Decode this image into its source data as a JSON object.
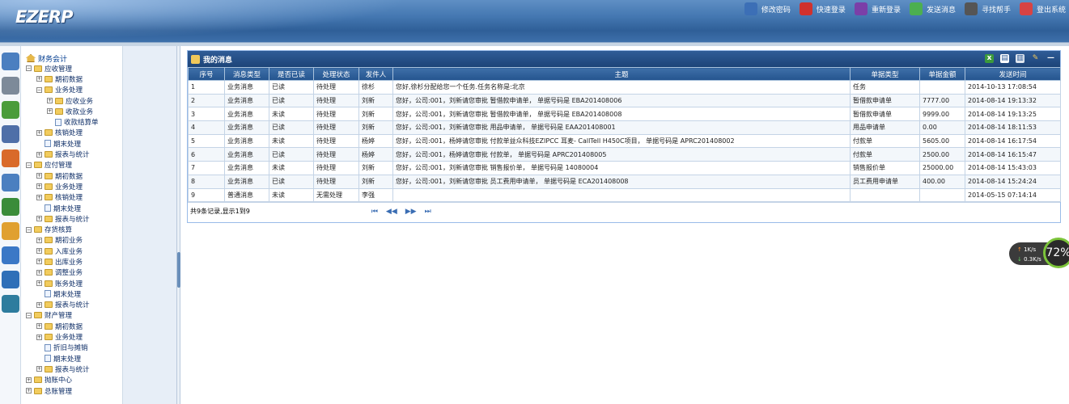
{
  "app": {
    "logo": "EZERP",
    "colors": {
      "header": "#3f72ad",
      "table_header": "#2f5c97",
      "accent": "#99bbe8"
    }
  },
  "topnav": [
    {
      "label": "修改密码",
      "icon": "user-edit-icon",
      "color": "#3c6fb6"
    },
    {
      "label": "快速登录",
      "icon": "car-icon",
      "color": "#d0312d"
    },
    {
      "label": "重新登录",
      "icon": "runner-icon",
      "color": "#7b3fa8"
    },
    {
      "label": "发送消息",
      "icon": "chat-icon",
      "color": "#4caf50"
    },
    {
      "label": "寻找帮手",
      "icon": "magnifier-icon",
      "color": "#555555"
    },
    {
      "label": "登出系统",
      "icon": "power-icon",
      "color": "#d84343"
    }
  ],
  "tree": {
    "root": "财务会计",
    "nodes": [
      {
        "label": "应收管理",
        "level": 0,
        "type": "folder",
        "toggle": "−"
      },
      {
        "label": "期初数据",
        "level": 1,
        "type": "folder",
        "toggle": "+"
      },
      {
        "label": "业务处理",
        "level": 1,
        "type": "folder",
        "toggle": "−"
      },
      {
        "label": "应收业务",
        "level": 2,
        "type": "folder",
        "toggle": "+"
      },
      {
        "label": "收款业务",
        "level": 2,
        "type": "folder",
        "toggle": "+"
      },
      {
        "label": "收款结算单",
        "level": 2,
        "type": "page",
        "toggle": ""
      },
      {
        "label": "核销处理",
        "level": 1,
        "type": "folder",
        "toggle": "+"
      },
      {
        "label": "期末处理",
        "level": 1,
        "type": "page",
        "toggle": ""
      },
      {
        "label": "报表与统计",
        "level": 1,
        "type": "folder",
        "toggle": "+"
      },
      {
        "label": "应付管理",
        "level": 0,
        "type": "folder",
        "toggle": "−"
      },
      {
        "label": "期初数据",
        "level": 1,
        "type": "folder",
        "toggle": "+"
      },
      {
        "label": "业务处理",
        "level": 1,
        "type": "folder",
        "toggle": "+"
      },
      {
        "label": "核销处理",
        "level": 1,
        "type": "folder",
        "toggle": "+"
      },
      {
        "label": "期末处理",
        "level": 1,
        "type": "page",
        "toggle": ""
      },
      {
        "label": "报表与统计",
        "level": 1,
        "type": "folder",
        "toggle": "+"
      },
      {
        "label": "存货核算",
        "level": 0,
        "type": "folder",
        "toggle": "−"
      },
      {
        "label": "期初业务",
        "level": 1,
        "type": "folder",
        "toggle": "+"
      },
      {
        "label": "入库业务",
        "level": 1,
        "type": "folder",
        "toggle": "+"
      },
      {
        "label": "出库业务",
        "level": 1,
        "type": "folder",
        "toggle": "+"
      },
      {
        "label": "调整业务",
        "level": 1,
        "type": "folder",
        "toggle": "+"
      },
      {
        "label": "账务处理",
        "level": 1,
        "type": "folder",
        "toggle": "+"
      },
      {
        "label": "期末处理",
        "level": 1,
        "type": "page",
        "toggle": ""
      },
      {
        "label": "报表与统计",
        "level": 1,
        "type": "folder",
        "toggle": "+"
      },
      {
        "label": "财产管理",
        "level": 0,
        "type": "folder",
        "toggle": "−"
      },
      {
        "label": "期初数据",
        "level": 1,
        "type": "folder",
        "toggle": "+"
      },
      {
        "label": "业务处理",
        "level": 1,
        "type": "folder",
        "toggle": "+"
      },
      {
        "label": "折旧与摊销",
        "level": 1,
        "type": "page",
        "toggle": ""
      },
      {
        "label": "期末处理",
        "level": 1,
        "type": "page",
        "toggle": ""
      },
      {
        "label": "报表与统计",
        "level": 1,
        "type": "folder",
        "toggle": "+"
      },
      {
        "label": "抛账中心",
        "level": 0,
        "type": "folder",
        "toggle": "+"
      },
      {
        "label": "总账管理",
        "level": 0,
        "type": "folder",
        "toggle": "+"
      }
    ]
  },
  "sideicons": [
    {
      "icon": "monitor-icon",
      "color": "#4b7fc0"
    },
    {
      "icon": "truck-icon",
      "color": "#7d8a99"
    },
    {
      "icon": "ledger-icon",
      "color": "#4a9c3a"
    },
    {
      "icon": "person-icon",
      "color": "#4f6fa8"
    },
    {
      "icon": "group-icon",
      "color": "#d96a2a"
    },
    {
      "icon": "calendar-icon",
      "color": "#4b7fc0"
    },
    {
      "icon": "book-icon",
      "color": "#3a8c3a"
    },
    {
      "icon": "folder-icon",
      "color": "#e0a030"
    },
    {
      "icon": "browser-icon",
      "color": "#3b78c6"
    },
    {
      "icon": "globe-icon",
      "color": "#2f6fb8"
    },
    {
      "icon": "earth-icon",
      "color": "#2e7c9e"
    }
  ],
  "panel": {
    "title": "我的消息",
    "columns": [
      "序号",
      "消息类型",
      "是否已读",
      "处理状态",
      "发件人",
      "主题",
      "单据类型",
      "单据金额",
      "发送时间"
    ],
    "rows": [
      [
        "1",
        "业务消息",
        "已读",
        "待处理",
        "徐杉",
        "您好,徐杉分配给您一个任务.任务名称是:北京",
        "任务",
        "",
        "2014-10-13 17:08:54"
      ],
      [
        "2",
        "业务消息",
        "已读",
        "待处理",
        "刘新",
        "您好，公司:001，刘新请您审批 暂借款申请单， 单据号码是 EBA201408006",
        "暂借款申请单",
        "7777.00",
        "2014-08-14 19:13:32"
      ],
      [
        "3",
        "业务消息",
        "未读",
        "待处理",
        "刘新",
        "您好，公司:001，刘新请您审批 暂借款申请单， 单据号码是 EBA201408008",
        "暂借款申请单",
        "9999.00",
        "2014-08-14 19:13:25"
      ],
      [
        "4",
        "业务消息",
        "已读",
        "待处理",
        "刘新",
        "您好，公司:001，刘新请您审批 用品申请单， 单据号码是 EAA201408001",
        "用品申请单",
        "0.00",
        "2014-08-14 18:11:53"
      ],
      [
        "5",
        "业务消息",
        "未读",
        "待处理",
        "杨婷",
        "您好，公司:001，杨婷请您审批 付款单益众科技EZIPCC 耳麦- CallTell H450C项目， 单据号码是 APRC201408002",
        "付款单",
        "5605.00",
        "2014-08-14 16:17:54"
      ],
      [
        "6",
        "业务消息",
        "已读",
        "待处理",
        "杨婷",
        "您好，公司:001，杨婷请您审批 付款单， 单据号码是 APRC201408005",
        "付款单",
        "2500.00",
        "2014-08-14 16:15:47"
      ],
      [
        "7",
        "业务消息",
        "未读",
        "待处理",
        "刘新",
        "您好，公司:001，刘新请您审批 销售报价单， 单据号码是 14080004",
        "销售报价单",
        "25000.00",
        "2014-08-14 15:43:03"
      ],
      [
        "8",
        "业务消息",
        "已读",
        "待处理",
        "刘新",
        "您好，公司:001，刘新请您审批 员工费用申请单， 单据号码是 ECA201408008",
        "员工费用申请单",
        "400.00",
        "2014-08-14 15:24:24"
      ],
      [
        "9",
        "普通消息",
        "未读",
        "无需处理",
        "李强",
        "",
        "",
        "",
        "2014-05-15 07:14:14"
      ]
    ],
    "pager_text": "共9条记录,显示1到9",
    "nav": {
      "first": "⏮",
      "prev": "◀◀",
      "next": "▶▶",
      "last": "⏭"
    }
  },
  "netwidget": {
    "up": "1K/s",
    "down": "0.3K/s",
    "percent": "72%"
  }
}
